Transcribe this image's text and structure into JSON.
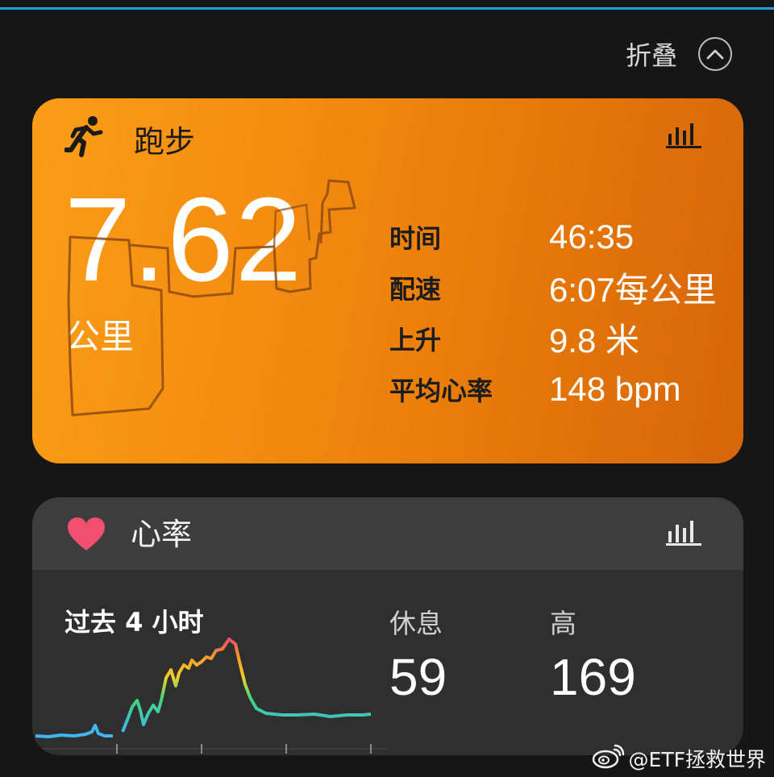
{
  "header": {
    "collapse_label": "折叠"
  },
  "run_card": {
    "title": "跑步",
    "distance": "7.62",
    "distance_unit": "公里",
    "stats": [
      {
        "label": "时间",
        "value": "46:35"
      },
      {
        "label": "配速",
        "value": "6:07每公里"
      },
      {
        "label": "上升",
        "value": "9.8 米"
      },
      {
        "label": "平均心率",
        "value": "148 bpm"
      }
    ],
    "gradient_colors": [
      "#fb9d17",
      "#d7650a"
    ]
  },
  "heart_card": {
    "title": "心率",
    "period": "过去 4 小时",
    "rest_label": "休息",
    "rest_value": "59",
    "high_label": "高",
    "high_value": "169",
    "heart_color": "#f0506e"
  },
  "watermark": {
    "text": "@ETF拯救世界"
  }
}
